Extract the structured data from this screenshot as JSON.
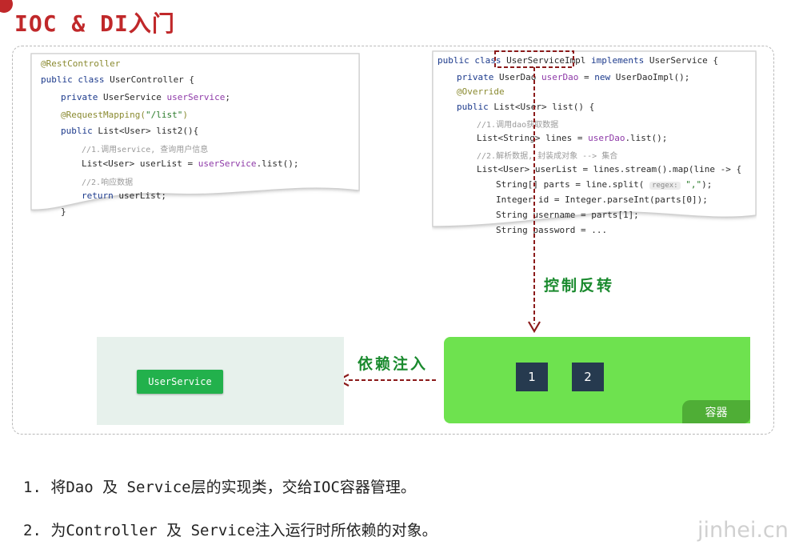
{
  "title": "IOC & DI入门",
  "controller_code": {
    "l1": "@RestController",
    "l2a": "public class ",
    "l2b": "UserController {",
    "l3a": "private ",
    "l3b": "UserService ",
    "l3c": "userService",
    "l3d": ";",
    "l4a": "@RequestMapping(",
    "l4b": "\"/list\"",
    "l4c": ")",
    "l5a": "public ",
    "l5b": "List<User> list2(){",
    "l6": "//1.调用service, 查询用户信息",
    "l7a": "List<User> userList = ",
    "l7b": "userService",
    "l7c": ".list();",
    "l8": "//2.响应数据",
    "l9a": "return ",
    "l9b": "userList;",
    "l10": "}"
  },
  "impl_code": {
    "l1a": "public class ",
    "l1b": "UserServiceImpl",
    "l1c": " implements ",
    "l1d": "UserService {",
    "l2a": "private ",
    "l2b": "UserDao ",
    "l2c": "userDao",
    "l2d": " = ",
    "l2e": "new ",
    "l2f": "UserDaoImpl();",
    "l3": "@Override",
    "l4a": "public ",
    "l4b": "List<User> list() {",
    "l5": "//1.调用dao获取数据",
    "l6a": "List<String> lines = ",
    "l6b": "userDao",
    "l6c": ".list();",
    "l7": "//2.解析数据, 封装成对象 --> 集合",
    "l8": "List<User> userList = lines.stream().map(line -> {",
    "l9a": "String[] parts = line.split( ",
    "l9b": "regex:",
    "l9c": " \",\"",
    "l9d": ");",
    "l10": "Integer id = Integer.parseInt(parts[0]);",
    "l11": "String username = parts[1];",
    "l12": "String password = ..."
  },
  "ioc_label": "控制反转",
  "di_label": "依赖注入",
  "service_button": "UserService",
  "container_boxes": [
    "1",
    "2"
  ],
  "container_label": "容器",
  "points": [
    "1. 将Dao 及 Service层的实现类，交给IOC容器管理。",
    "2. 为Controller 及 Service注入运行时所依赖的对象。"
  ],
  "watermark": "jinhei.cn",
  "colors": {
    "title": "#c0282a",
    "container": "#6ee24f",
    "service": "#22b14c",
    "arrow": "#8b1a1a",
    "label": "#1a8a2e"
  }
}
